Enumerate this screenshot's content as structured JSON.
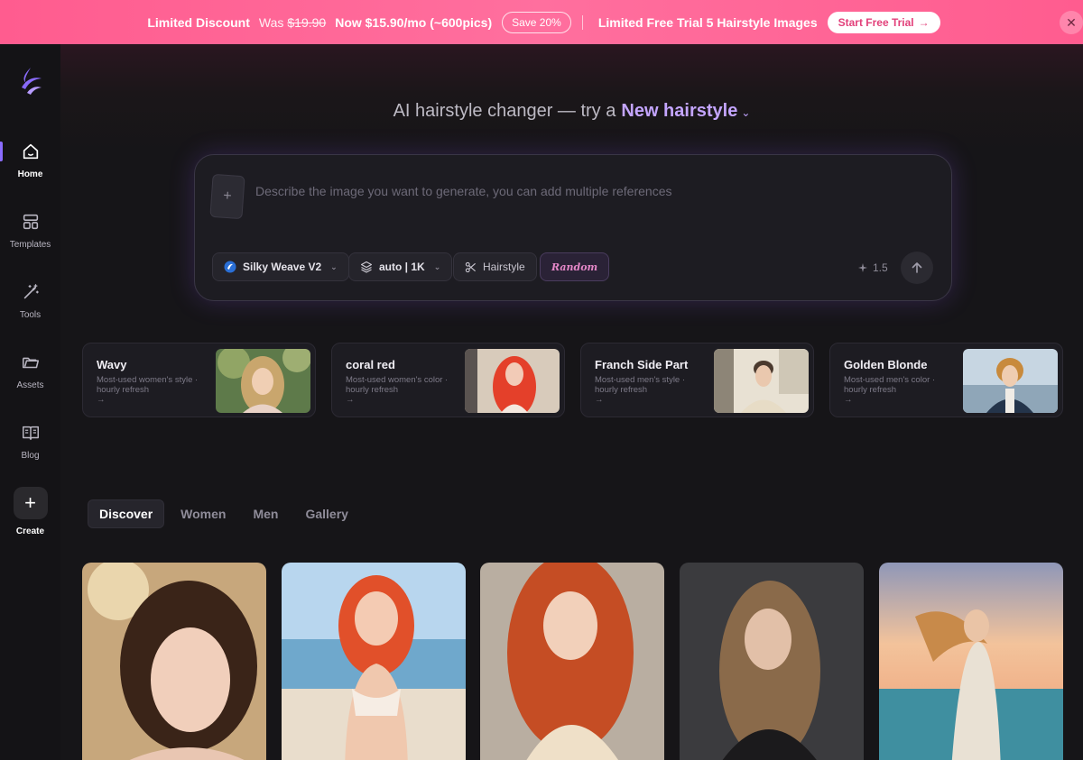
{
  "banner": {
    "discount_label": "Limited Discount",
    "was_label": "Was",
    "was_price": "$19.90",
    "now_price": "Now $15.90/mo (~600pics)",
    "save_badge": "Save 20%",
    "trial_text": "Limited Free Trial 5 Hairstyle Images",
    "trial_button": "Start Free Trial",
    "colors": {
      "background": "#ff5c8f",
      "button_text": "#e2407a"
    }
  },
  "sidebar": {
    "items": [
      {
        "label": "Home",
        "icon": "home-icon",
        "active": true
      },
      {
        "label": "Templates",
        "icon": "templates-icon"
      },
      {
        "label": "Tools",
        "icon": "magic-wand-icon"
      },
      {
        "label": "Assets",
        "icon": "folder-icon"
      },
      {
        "label": "Blog",
        "icon": "book-icon"
      },
      {
        "label": "Create",
        "icon": "plus-icon"
      }
    ],
    "accent": "#8b6cff"
  },
  "hero": {
    "prefix": "AI hairstyle changer — try a",
    "accent_text": "New hairstyle",
    "accent_color": "#c4a5ff"
  },
  "prompt": {
    "placeholder": "Describe the image you want to generate, you can add multiple references",
    "model": "Silky Weave V2",
    "size": "auto | 1K",
    "mode": "Hairstyle",
    "random": "Random",
    "credits": "1.5"
  },
  "styles": [
    {
      "title": "Wavy",
      "desc": "Most-used women's style  ·  hourly refresh"
    },
    {
      "title": "coral red",
      "desc": "Most-used women's color  ·  hourly refresh"
    },
    {
      "title": "Franch Side Part",
      "desc": "Most-used men's style  ·  hourly refresh"
    },
    {
      "title": "Golden Blonde",
      "desc": "Most-used men's color  ·  hourly refresh"
    }
  ],
  "tabs": [
    "Discover",
    "Women",
    "Men",
    "Gallery"
  ],
  "active_tab": "Discover"
}
